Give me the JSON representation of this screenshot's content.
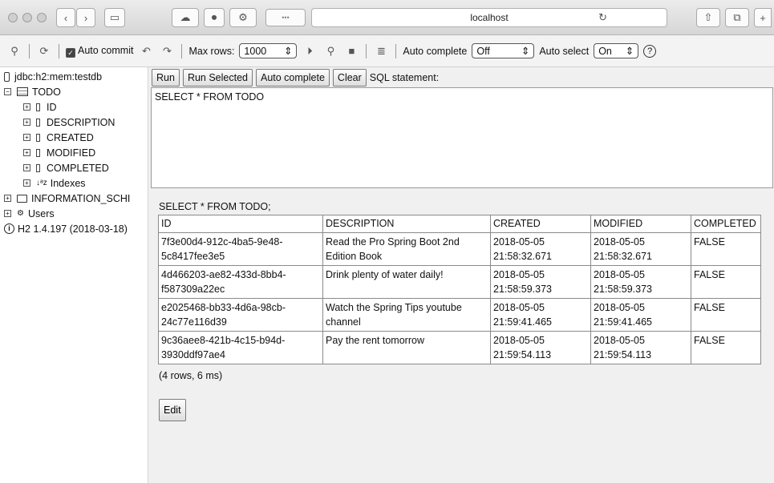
{
  "browser": {
    "url": "localhost",
    "reload_icon": "reload-icon"
  },
  "toolbar": {
    "auto_commit_label": "Auto commit",
    "max_rows_label": "Max rows:",
    "max_rows_value": "1000",
    "auto_complete_label": "Auto complete",
    "auto_complete_value": "Off",
    "auto_select_label": "Auto select",
    "auto_select_value": "On",
    "help_glyph": "?"
  },
  "tree": {
    "db_url": "jdbc:h2:mem:testdb",
    "table_name": "TODO",
    "columns": [
      "ID",
      "DESCRIPTION",
      "CREATED",
      "MODIFIED",
      "COMPLETED"
    ],
    "indexes_label": "Indexes",
    "info_schema_label": "INFORMATION_SCHI",
    "users_label": "Users",
    "version_label": "H2 1.4.197 (2018-03-18)"
  },
  "query": {
    "run_label": "Run",
    "run_selected_label": "Run Selected",
    "auto_complete_label": "Auto complete",
    "clear_label": "Clear",
    "sql_statement_label": "SQL statement:",
    "sql_text": "SELECT * FROM TODO"
  },
  "results": {
    "title": "SELECT * FROM TODO;",
    "headers": [
      "ID",
      "DESCRIPTION",
      "CREATED",
      "MODIFIED",
      "COMPLETED"
    ],
    "rows": [
      [
        "7f3e00d4-912c-4ba5-9e48-5c8417fee3e5",
        "Read the Pro Spring Boot 2nd Edition Book",
        "2018-05-05 21:58:32.671",
        "2018-05-05 21:58:32.671",
        "FALSE"
      ],
      [
        "4d466203-ae82-433d-8bb4-f587309a22ec",
        "Drink plenty of water daily!",
        "2018-05-05 21:58:59.373",
        "2018-05-05 21:58:59.373",
        "FALSE"
      ],
      [
        "e2025468-bb33-4d6a-98cb-24c77e116d39",
        "Watch the Spring Tips youtube channel",
        "2018-05-05 21:59:41.465",
        "2018-05-05 21:59:41.465",
        "FALSE"
      ],
      [
        "9c36aee8-421b-4c15-b94d-3930ddf97ae4",
        "Pay the rent tomorrow",
        "2018-05-05 21:59:54.113",
        "2018-05-05 21:59:54.113",
        "FALSE"
      ]
    ],
    "summary": "(4 rows, 6 ms)",
    "edit_label": "Edit"
  }
}
